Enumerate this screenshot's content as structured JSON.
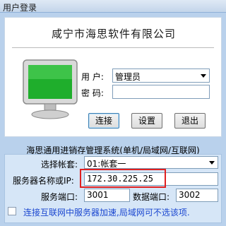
{
  "window": {
    "title": "用户登录"
  },
  "header": {
    "company_name": "咸宁市海思软件有限公司"
  },
  "login": {
    "user_label": "用  户:",
    "user_value": "管理员",
    "password_label": "密  码:",
    "password_value": ""
  },
  "buttons": {
    "connect": "连接",
    "settings": "设置",
    "exit": "退出"
  },
  "system_name": "海思通用进销存管理系统(单机/局域网/互联网)",
  "server": {
    "account_set_label": "选择帐套:",
    "account_set_value": "01:帐套一",
    "server_label": "服务器名称或IP:",
    "server_value": "172.30.225.25",
    "service_port_label": "服务端口:",
    "service_port_value": "3001",
    "data_port_label": "数据端口:",
    "data_port_value": "3002",
    "accelerate_label": "连接互联网中服务器加速,局域网可不选该项.",
    "accelerate_checked": false
  },
  "colors": {
    "accent": "#3c7fb1",
    "highlight": "#e02020",
    "hint_text": "#1b47d0"
  }
}
